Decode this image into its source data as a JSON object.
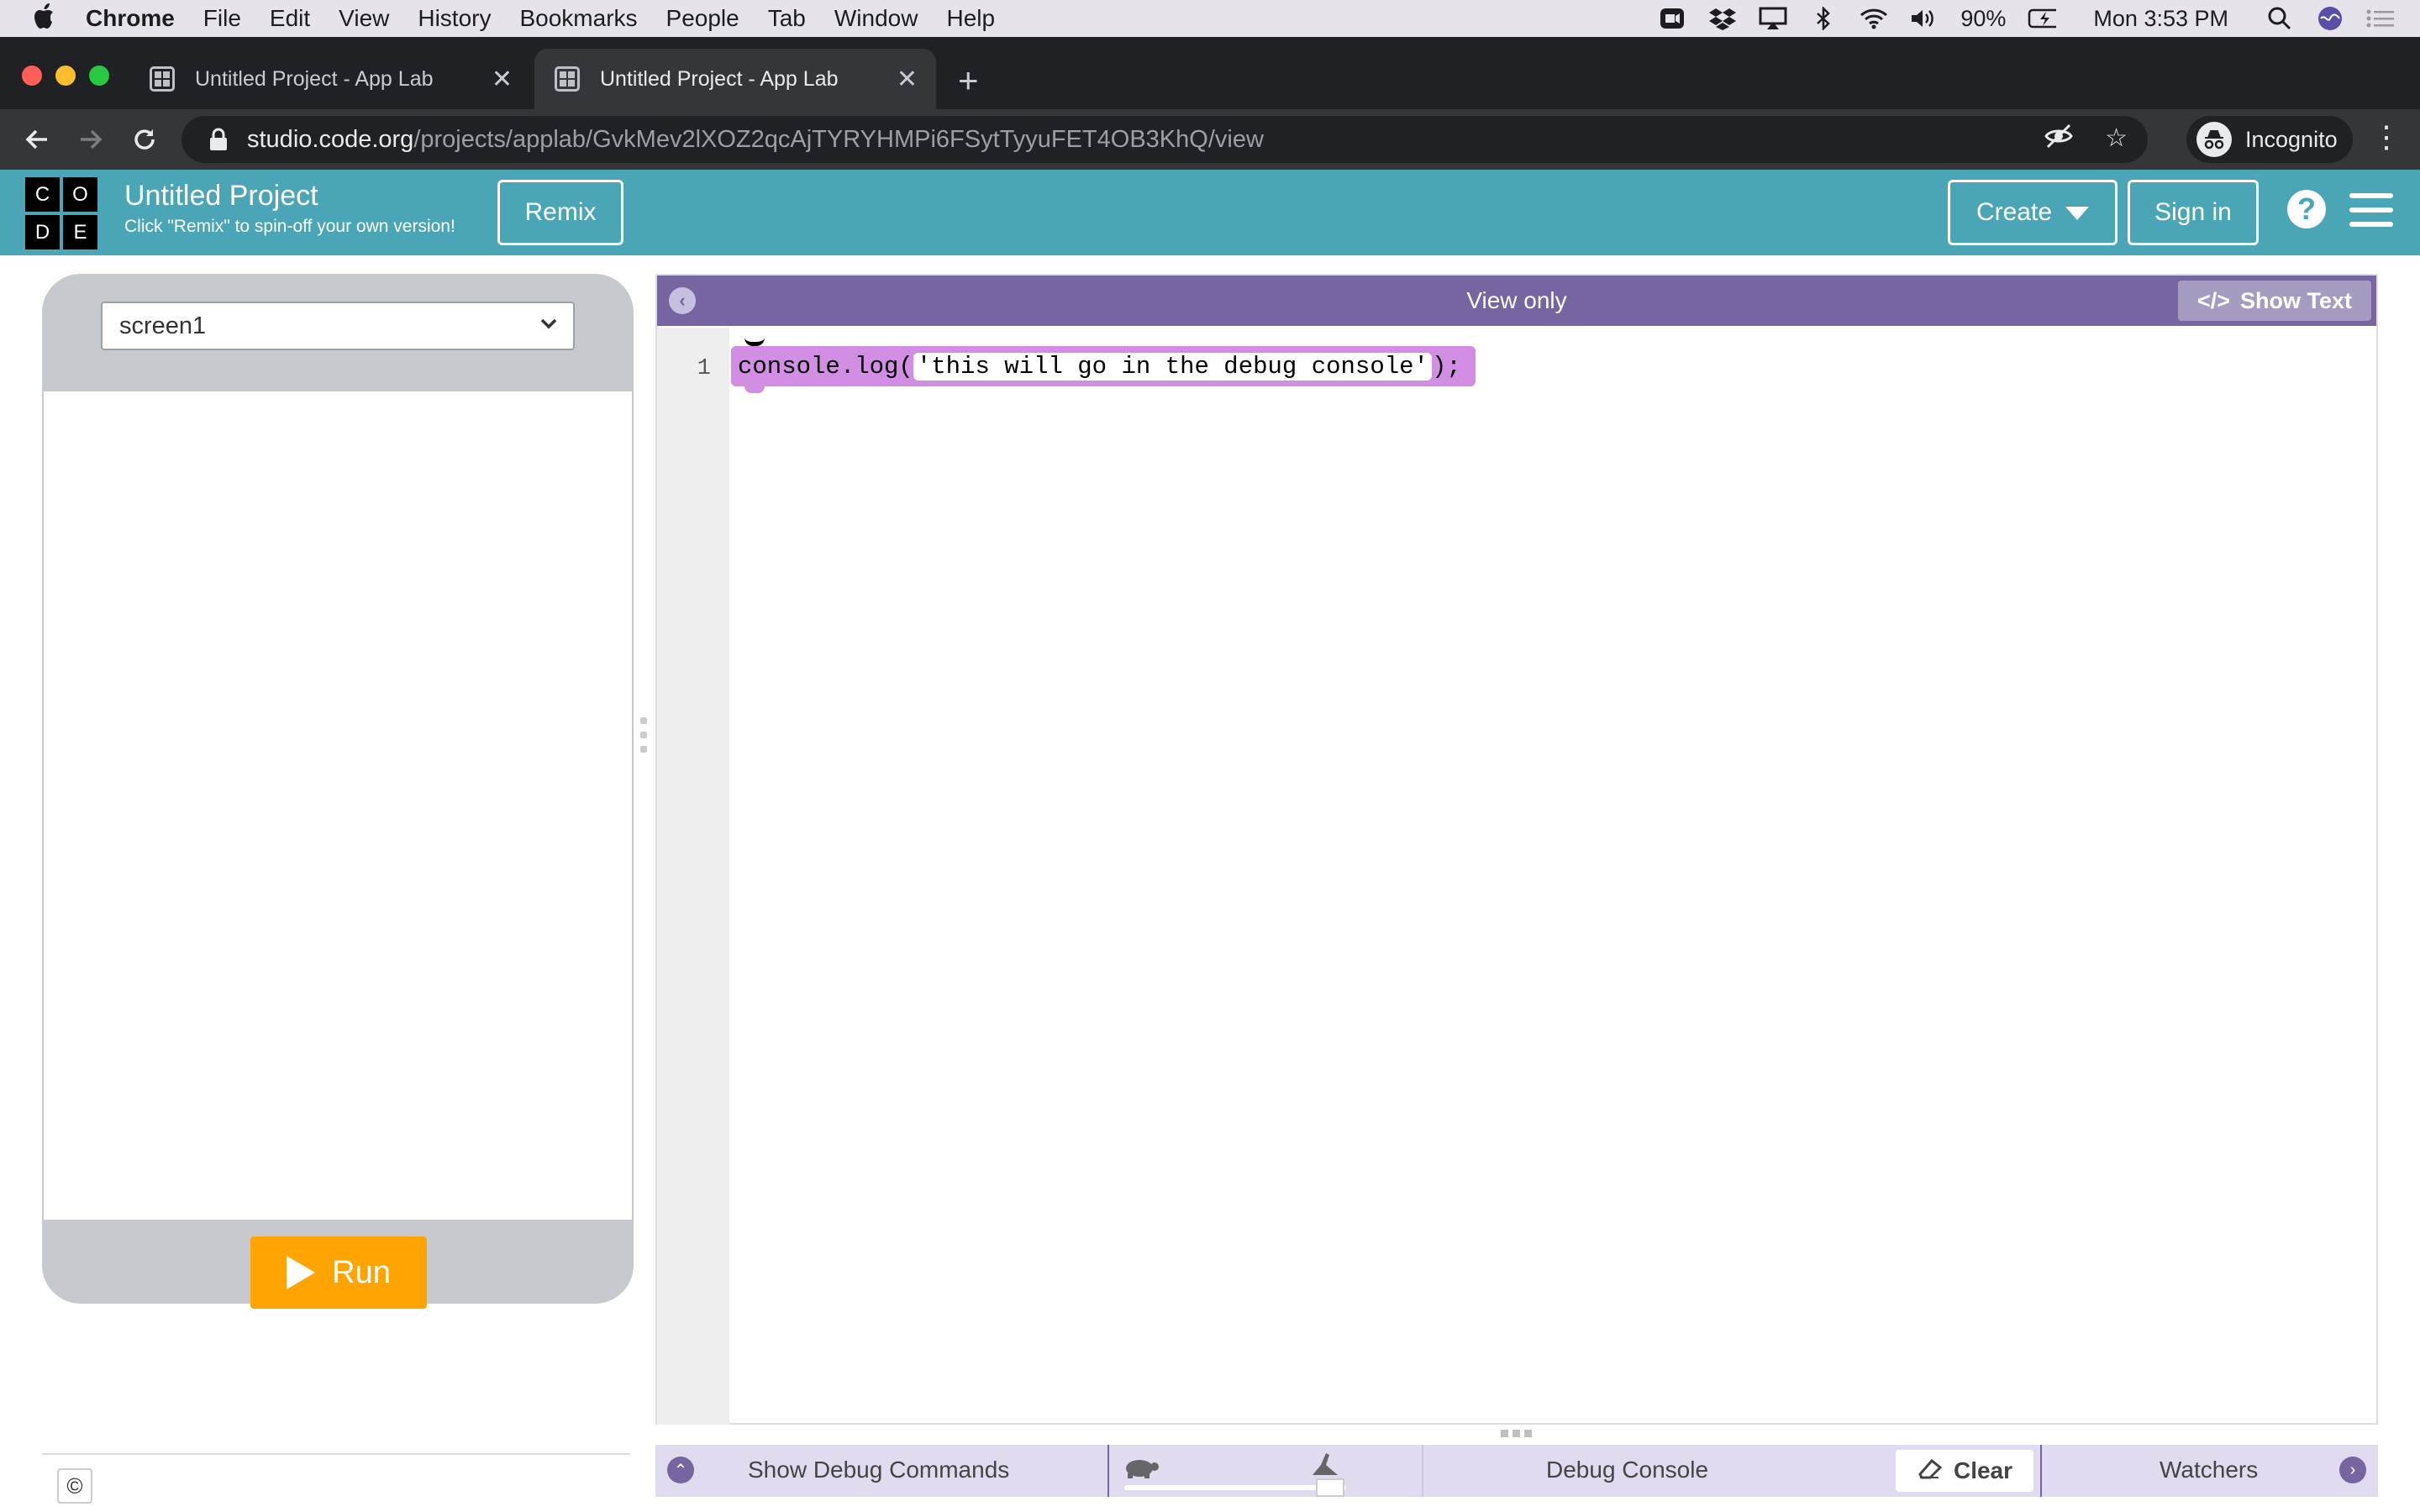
{
  "menubar": {
    "app_name": "Chrome",
    "items": [
      "File",
      "Edit",
      "View",
      "History",
      "Bookmarks",
      "People",
      "Tab",
      "Window",
      "Help"
    ],
    "battery": "90%",
    "clock": "Mon 3:53 PM"
  },
  "browser": {
    "tabs": [
      {
        "title": "Untitled Project - App Lab",
        "active": false
      },
      {
        "title": "Untitled Project - App Lab",
        "active": true
      }
    ],
    "new_tab_label": "+",
    "url_host": "studio.code.org",
    "url_path": "/projects/applab/GvkMev2lXOZ2qcAjTYRYHMPi6FSytTyyuFET4OB3KhQ/view",
    "profile_label": "Incognito"
  },
  "header": {
    "logo_letters": [
      "C",
      "O",
      "D",
      "E"
    ],
    "project_title": "Untitled Project",
    "project_subtitle": "Click \"Remix\" to spin-off your own version!",
    "remix_label": "Remix",
    "create_label": "Create",
    "signin_label": "Sign in",
    "help_label": "?"
  },
  "phone": {
    "screen_selector_value": "screen1",
    "run_label": "Run"
  },
  "editor": {
    "mode_label": "View only",
    "show_text_label": "Show Text",
    "line_number": "1",
    "code_prefix": "console.log(",
    "code_string": "'this will go in the debug console'",
    "code_suffix": ");"
  },
  "debug": {
    "show_commands_label": "Show Debug Commands",
    "console_label": "Debug Console",
    "clear_label": "Clear",
    "watchers_label": "Watchers"
  },
  "footer": {
    "copyright_symbol": "©"
  },
  "colors": {
    "header_teal": "#4aa6b6",
    "editor_purple": "#7665a0",
    "run_orange": "#ffa400",
    "code_block": "#d18ee2"
  }
}
